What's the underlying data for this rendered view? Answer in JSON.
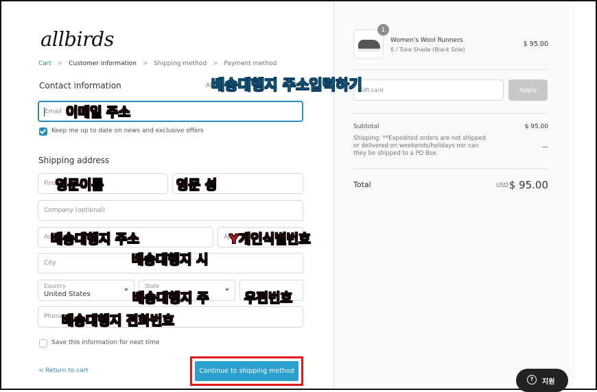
{
  "brand": {
    "logo": "allbirds"
  },
  "breadcrumb": [
    {
      "label": "Cart",
      "state": "link"
    },
    {
      "label": "Customer information",
      "state": "current"
    },
    {
      "label": "Shipping method",
      "state": "future"
    },
    {
      "label": "Payment method",
      "state": "future"
    }
  ],
  "breadcrumb_sep": ">",
  "contact": {
    "title": "Contact information",
    "account_hint": "Al",
    "email_placeholder": "Email",
    "newsletter_label": "Keep me up to date on news and exclusive offers",
    "newsletter_checked": true
  },
  "shipping": {
    "title": "Shipping address",
    "first_name_placeholder": "First",
    "last_name_placeholder": "",
    "company_placeholder": "Company (optional)",
    "address_placeholder": "Ad",
    "apt_placeholder": "Ap",
    "city_placeholder": "City",
    "country_label": "Country",
    "country_value": "United States",
    "state_placeholder": "State",
    "zip_placeholder": "",
    "phone_placeholder": "Phone",
    "save_label": "Save this information for next time",
    "save_checked": false
  },
  "footer": {
    "return_label": "< Return to cart",
    "continue_label": "Continue to shipping method"
  },
  "annotations": {
    "top": "배송대행지 주소입력하기",
    "email": "이메일 주소",
    "first_name": "영문이름",
    "last_name": "영문 성",
    "address": "배송대행지 주소",
    "apt": "Y개인식별번호",
    "city": "배송대행지 시",
    "state": "배송대행지 주",
    "zip": "우편번호",
    "phone": "배송대행지 전화번호"
  },
  "order": {
    "product_name": "Women's Wool Runners",
    "product_variant": "6 / Tuke Shade (Black Sole)",
    "product_price": "$ 95.00",
    "quantity": "1",
    "gift_placeholder": "Gift card",
    "apply_label": "Apply",
    "subtotal_label": "Subtotal",
    "subtotal_value": "$ 95.00",
    "shipping_note": "Shipping: **Expedited orders are not shipped or delivered on weekends/holidays nor can they be shipped to a PO Box.",
    "shipping_value": "—",
    "total_label": "Total",
    "total_currency": "USD",
    "total_value": "$ 95.00"
  },
  "help": {
    "label": "지원"
  },
  "colors": {
    "accent": "#2a9fd0",
    "annotation": "#d9141b",
    "highlight_box": "#e01919"
  }
}
